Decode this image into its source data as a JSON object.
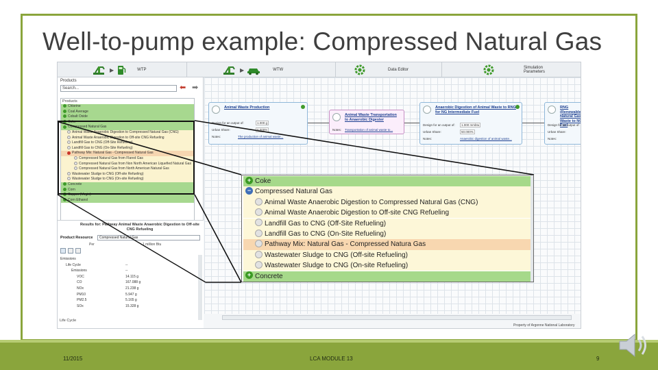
{
  "slide": {
    "title": "Well-to-pump example: Compressed Natural Gas",
    "footer": {
      "date": "11/2015",
      "module": "LCA MODULE 13",
      "page": "9"
    }
  },
  "toolbar": {
    "wtp_label": "WTP",
    "wtw_label": "WTW",
    "data_editor_label": "Data Editor",
    "simulation_label": "Simulation\nParameters"
  },
  "products_panel": {
    "heading": "Products",
    "search_placeholder": "Search...",
    "list_heading": "Products",
    "rows": [
      {
        "label": "Chlorine",
        "style": "green",
        "icon": "plus"
      },
      {
        "label": "Coal Average",
        "style": "green",
        "icon": "plus"
      },
      {
        "label": "Cobalt Oxide",
        "style": "green",
        "icon": "plus"
      },
      {
        "label": "Coke",
        "style": "green",
        "icon": "plus"
      },
      {
        "label": "Compressed Natural Gas",
        "style": "green",
        "icon": "minus"
      },
      {
        "label": "Animal Waste Anaerobic Digestion to Compressed Natural Gas (CNG)",
        "style": "yellow",
        "icon": "gray"
      },
      {
        "label": "Animal Waste Anaerobic Digestion to Off-site CNG Refueling",
        "style": "yellow",
        "icon": "gray"
      },
      {
        "label": "Landfill Gas to CNG (Off-Site Refueling)",
        "style": "yellow",
        "icon": "gray"
      },
      {
        "label": "Landfill Gas to CNG (On-Site Refueling)",
        "style": "yellow",
        "icon": "gray"
      },
      {
        "label": "Pathway Mix: Natural Gas - Compressed Natural Gas",
        "style": "orange",
        "icon": "red"
      },
      {
        "label": "Compressed Natural Gas from Flared Gas",
        "style": "yellow",
        "icon": "gray"
      },
      {
        "label": "Compressed Natural Gas from Non North American Liquefied Natural Gas",
        "style": "yellow",
        "icon": "gray"
      },
      {
        "label": "Compressed Natural Gas from North American Natural Gas",
        "style": "yellow",
        "icon": "gray"
      },
      {
        "label": "Wastewater Sludge to CNG (Off-site Refueling)",
        "style": "yellow",
        "icon": "gray"
      },
      {
        "label": "Wastewater Sludge to CNG (On-site Refueling)",
        "style": "yellow",
        "icon": "gray"
      },
      {
        "label": "Concrete",
        "style": "green",
        "icon": "plus"
      },
      {
        "label": "Corn",
        "style": "green",
        "icon": "plus"
      },
      {
        "label": "Copper (Virgin)",
        "style": "green",
        "icon": "plus"
      },
      {
        "label": "Corn Ethanol",
        "style": "green",
        "icon": "plus"
      }
    ]
  },
  "results_panel": {
    "title": "Results for: Pathway Animal Waste Anaerobic Digestion to Off-site CNG Refueling",
    "product_resource_label": "Product Resource",
    "product_resource_value": "Compressed Natural Gas",
    "col_per": "Per",
    "col_unit": "1 million Btu",
    "rows": [
      {
        "key": "Emissions",
        "value": "",
        "indent": 0
      },
      {
        "key": "Life Cycle",
        "value": "--",
        "indent": 1
      },
      {
        "key": "Emissions",
        "value": "--",
        "indent": 2
      },
      {
        "key": "VOC",
        "value": "14.115 g",
        "indent": 3
      },
      {
        "key": "CO",
        "value": "167.088 g",
        "indent": 3
      },
      {
        "key": "NOx",
        "value": "21.238 g",
        "indent": 3
      },
      {
        "key": "PM10",
        "value": "5.947 g",
        "indent": 3
      },
      {
        "key": "PM2.5",
        "value": "5.165 g",
        "indent": 3
      },
      {
        "key": "SOx",
        "value": "15.328 g",
        "indent": 3
      }
    ],
    "footer_label": "Life Cycle"
  },
  "canvas": {
    "nodes": [
      {
        "title": "Animal Waste Production",
        "design_label": "Design for an output of:",
        "design_value": "1.000 g",
        "share_label": "Urban Share:",
        "share_value": "0.000%",
        "notes_label": "Notes:",
        "notes_value": "The production of animal waste..."
      },
      {
        "title": "Animal Waste Transportation to Anaerobic Digester",
        "notes_label": "Notes:",
        "notes_value": "Transportation of animal waste to..."
      },
      {
        "title": "Anaerobic Digestion of Animal Waste to RNG for NG Intermediate Fuel",
        "design_label": "Design for an output of:",
        "design_value": "1.000 mmbtu",
        "share_label": "Urban Share:",
        "share_value": "50.000%",
        "notes_label": "Notes:",
        "notes_value": "Anaerobic digestion of animal waste..."
      },
      {
        "title": "RNG (Renewable Natural Gas) Waste to NG Fuel",
        "design_label": "Design for an output of:",
        "share_label": "Urban Share:",
        "notes_label": "Notes:"
      }
    ],
    "copyright": "Property of Argonne National Laboratory"
  },
  "zoom": {
    "rows": [
      {
        "label": "Coke",
        "style": "green",
        "icon": "g plus",
        "indent": false
      },
      {
        "label": "Compressed Natural Gas",
        "style": "yellow",
        "icon": "b minus",
        "indent": false
      },
      {
        "label": "Animal Waste Anaerobic Digestion to Compressed Natural Gas (CNG)",
        "style": "yellow",
        "icon": "gray",
        "indent": true
      },
      {
        "label": "Animal Waste Anaerobic Digestion to Off-site CNG Refueling",
        "style": "yellow",
        "icon": "gray",
        "indent": true
      },
      {
        "label": "Landfill Gas to CNG (Off-Site Refueling)",
        "style": "yellow",
        "icon": "gray",
        "indent": true
      },
      {
        "label": "Landfill Gas to CNG (On-Site Refueling)",
        "style": "yellow",
        "icon": "gray",
        "indent": true
      },
      {
        "label": "Pathway Mix: Natural Gas - Compressed Natura Gas",
        "style": "orange",
        "icon": "gray",
        "indent": true
      },
      {
        "label": "Wastewater Sludge to CNG (Off-site Refueling)",
        "style": "yellow",
        "icon": "gray",
        "indent": true
      },
      {
        "label": "Wastewater Sludge to CNG (On-site Refueling)",
        "style": "yellow",
        "icon": "gray",
        "indent": true
      },
      {
        "label": "Concrete",
        "style": "green",
        "icon": "g plus",
        "indent": false
      }
    ]
  },
  "colors": {
    "accent_green": "#8aa53c",
    "row_green": "#a6d98a",
    "row_yellow": "#fdf7d8",
    "row_orange": "#f8d7b0"
  }
}
